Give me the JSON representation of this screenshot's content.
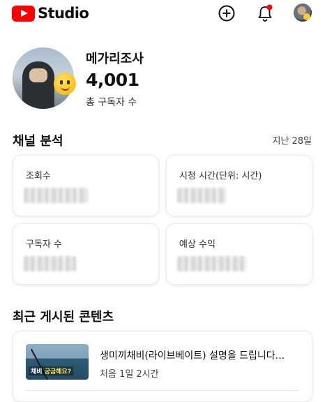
{
  "header": {
    "app_name": "Studio",
    "create_icon": "plus-circle-icon",
    "notification_icon": "bell-icon",
    "notification_dot_color": "#ff0000",
    "brand_color": "#ff0000"
  },
  "channel": {
    "name": "메가리조사",
    "subscriber_count": "4,001",
    "subscriber_label": "총 구독자 수"
  },
  "analytics": {
    "title": "채널 분석",
    "period": "지난 28일",
    "cards": [
      {
        "label": "조회수"
      },
      {
        "label": "시청 시간(단위: 시간)"
      },
      {
        "label": "구독자 수"
      },
      {
        "label": "예상 수익"
      }
    ]
  },
  "recent": {
    "title": "최근 게시된 콘텐츠",
    "items": [
      {
        "thumbnail_text_white": "채비 ",
        "thumbnail_text_yellow": "궁금해요?",
        "title": "생미끼채비(라이브베이트) 설명을 드립니다...",
        "meta": "처음 1일 2시간"
      }
    ]
  }
}
